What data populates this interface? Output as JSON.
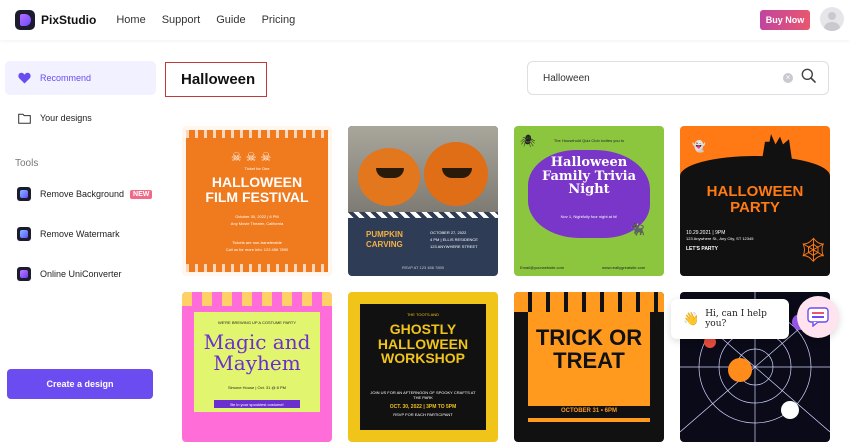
{
  "app": {
    "name": "PixStudio"
  },
  "nav": {
    "items": [
      "Home",
      "Support",
      "Guide",
      "Pricing"
    ],
    "buy_label": "Buy Now"
  },
  "sidebar": {
    "recommend": "Recommend",
    "your_designs": "Your designs",
    "tools_label": "Tools",
    "tools": [
      {
        "label": "Remove Background",
        "badge": "NEW"
      },
      {
        "label": "Remove Watermark"
      },
      {
        "label": "Online UniConverter"
      }
    ],
    "create_label": "Create a design"
  },
  "main": {
    "title": "Halloween",
    "search_value": "Halloween"
  },
  "cards": [
    {
      "small": "Ticket for One",
      "title": "HALLOWEEN FILM FESTIVAL",
      "sub": "October 30, 2022 | 8 PM",
      "sub2": "Any Movie Theater, California",
      "sub3": "Tickets are non-transferable",
      "sub4": "Call us for more info: 123 456 7890"
    },
    {
      "title": "PUMPKIN CARVING",
      "sub": "OCTOBER 27, 2022",
      "sub2": "4 PM | ELLIS RESIDENCE",
      "sub3": "123 ANYWHERE STREET",
      "sub4": "RSVP AT 123 456 7890"
    },
    {
      "small": "The Household Quiz Club invites you to",
      "title": "Halloween Family Trivia Night",
      "sub": "Nov 1, Nightfully four night at hi!",
      "sub2": "Email@yourwebsite.com",
      "sub3": "www.reallygreatsite.com"
    },
    {
      "title": "HALLOWEEN PARTY",
      "sub": "10.29.2021 | 9PM",
      "sub2": "123 Anywhere St., Any City, ST 12345",
      "sub3": "LET'S PARTY"
    },
    {
      "small": "WE'RE BREWING UP A COSTUME PARTY",
      "title": "Magic and Mayhem",
      "sub": "Simone House | Oct. 31 @ 8 PM",
      "sub2": "Be in your spookiest costume!"
    },
    {
      "small": "THE TOOTS AND",
      "title": "GHOSTLY HALLOWEEN WORKSHOP",
      "sub": "JOIN US FOR AN AFTERNOON OF SPOOKY CRAFTS AT THE PARK",
      "sub2": "OCT. 30, 2022 | 3PM TO 5PM",
      "sub3": "RSVP FOR EACH PARTICIPANT"
    },
    {
      "title": "TRICK OR TREAT",
      "sub": "OCTOBER 31 • 6PM"
    },
    {
      "title": "",
      "sub": ""
    }
  ],
  "chat": {
    "text": "Hi, can I help you?"
  }
}
